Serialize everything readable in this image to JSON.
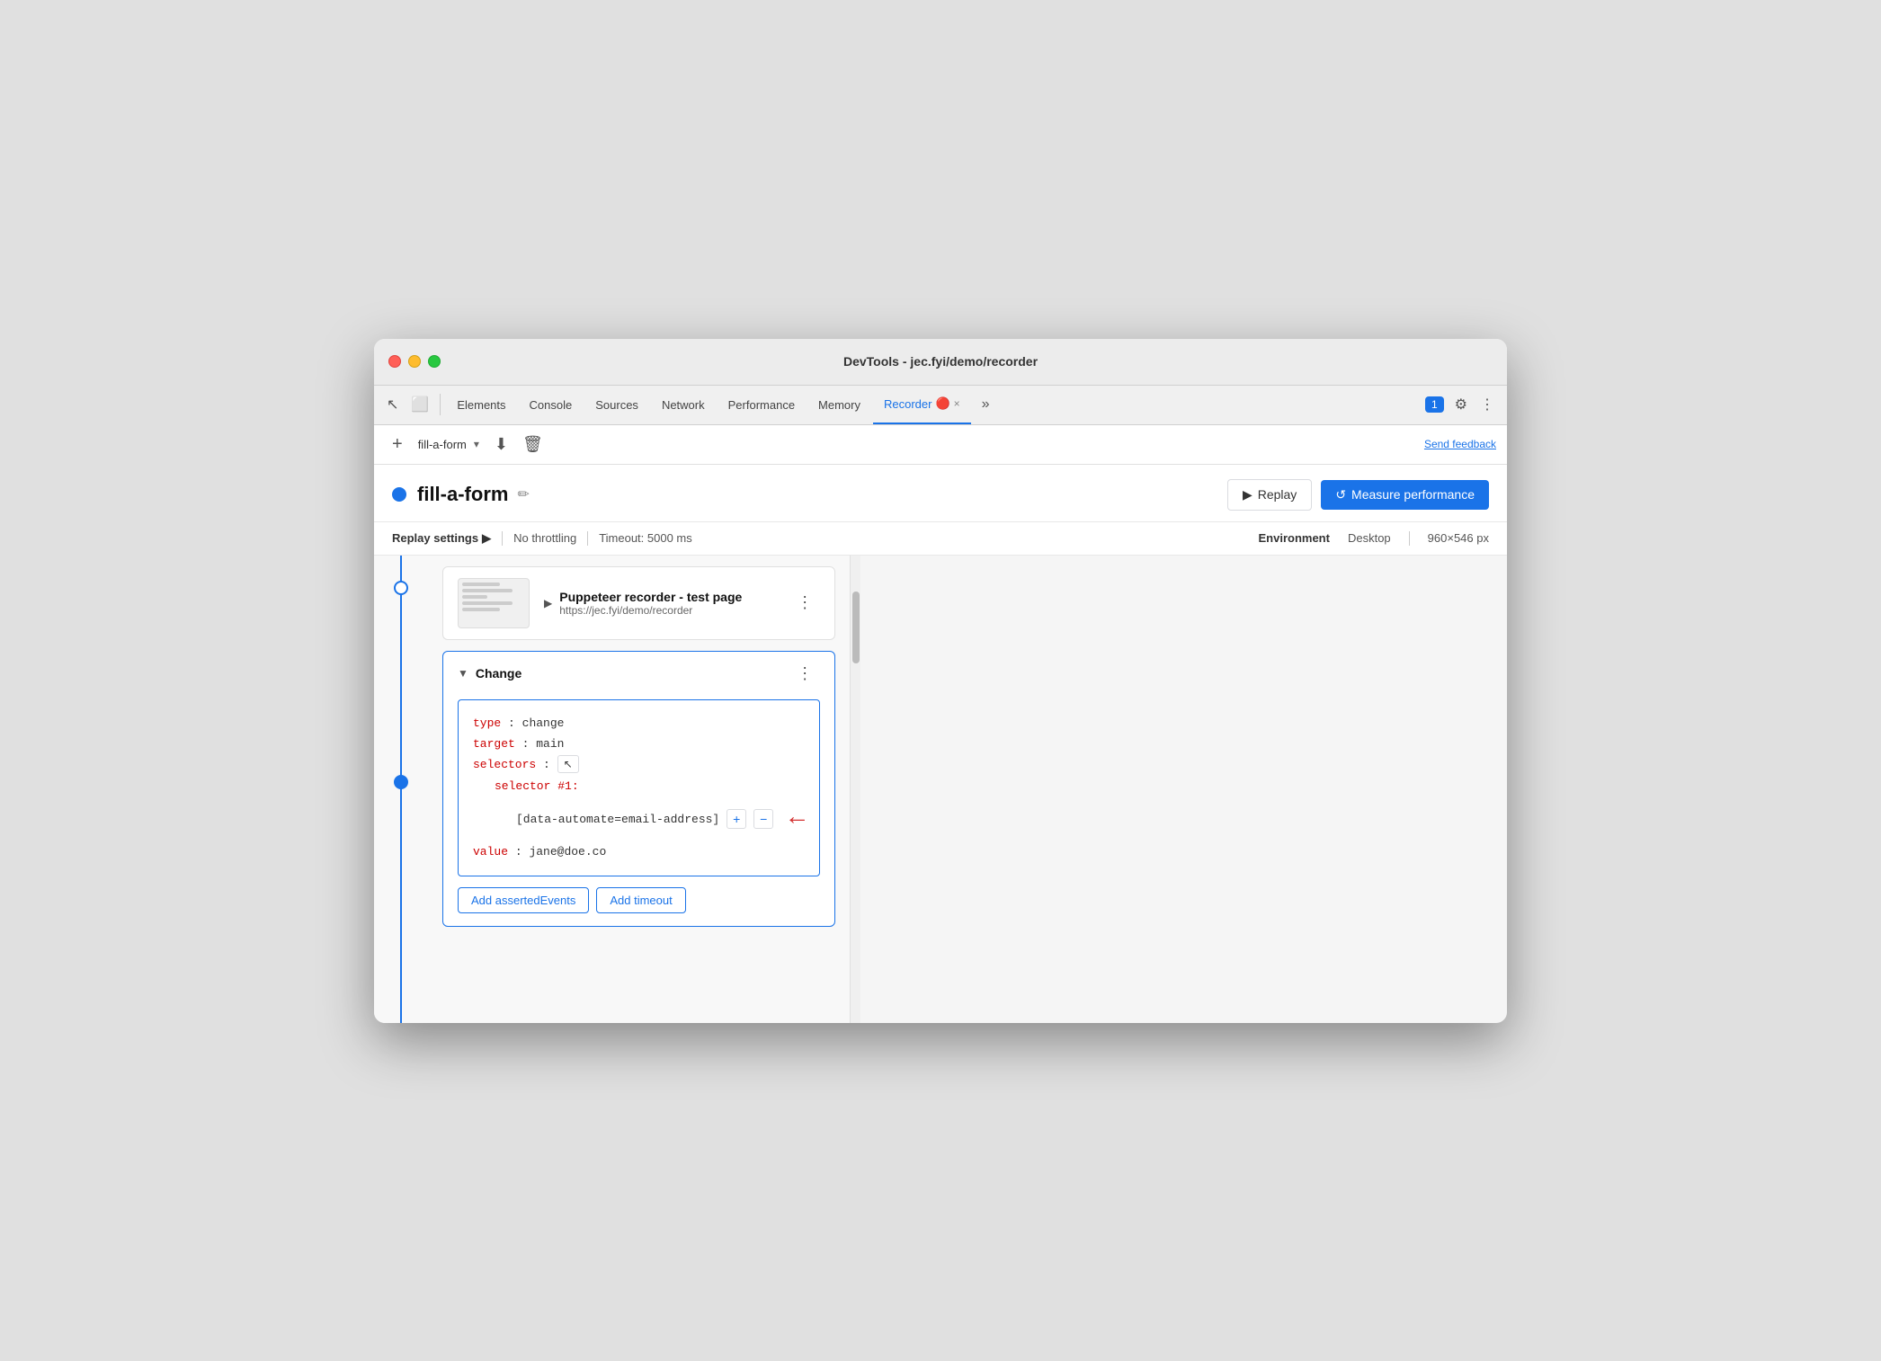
{
  "window": {
    "title": "DevTools - jec.fyi/demo/recorder"
  },
  "traffic_lights": {
    "red_label": "close",
    "yellow_label": "minimize",
    "green_label": "maximize"
  },
  "devtools_tabs": {
    "tabs": [
      {
        "label": "Elements",
        "active": false
      },
      {
        "label": "Console",
        "active": false
      },
      {
        "label": "Sources",
        "active": false
      },
      {
        "label": "Network",
        "active": false
      },
      {
        "label": "Performance",
        "active": false
      },
      {
        "label": "Memory",
        "active": false
      },
      {
        "label": "Recorder",
        "active": true
      }
    ],
    "overflow_label": "»",
    "badge_count": "1",
    "settings_icon": "⚙",
    "more_icon": "⋮",
    "inspector_icon": "↖",
    "device_icon": "⬜",
    "close_tab_icon": "×"
  },
  "recorder_toolbar": {
    "add_btn": "+",
    "recording_name": "fill-a-form",
    "chevron": "▾",
    "download_btn": "⬇",
    "delete_btn": "🗑",
    "send_feedback": "Send feedback"
  },
  "recording_header": {
    "name": "fill-a-form",
    "edit_icon": "✏",
    "replay_btn": "Replay",
    "replay_icon": "▶",
    "measure_btn": "Measure performance",
    "measure_icon": "↺"
  },
  "settings_bar": {
    "heading": "Replay settings",
    "expand_icon": "▶",
    "throttling": "No throttling",
    "timeout": "Timeout: 5000 ms",
    "env_label": "Environment",
    "desktop": "Desktop",
    "resolution": "960×546 px"
  },
  "page_step": {
    "title": "Puppeteer recorder - test page",
    "url": "https://jec.fyi/demo/recorder",
    "menu_icon": "⋮",
    "expand_icon": "▶"
  },
  "change_step": {
    "title": "Change",
    "menu_icon": "⋮",
    "collapse_icon": "▼",
    "code": {
      "type_key": "type",
      "type_val": "change",
      "target_key": "target",
      "target_val": "main",
      "selectors_key": "selectors",
      "selector_num_key": "selector #1:",
      "selector_val": "[data-automate=email-address]",
      "value_key": "value",
      "value_val": "jane@doe.co"
    },
    "add_asserted_btn": "Add assertedEvents",
    "add_timeout_btn": "Add timeout",
    "add_icon": "+",
    "remove_icon": "−"
  }
}
